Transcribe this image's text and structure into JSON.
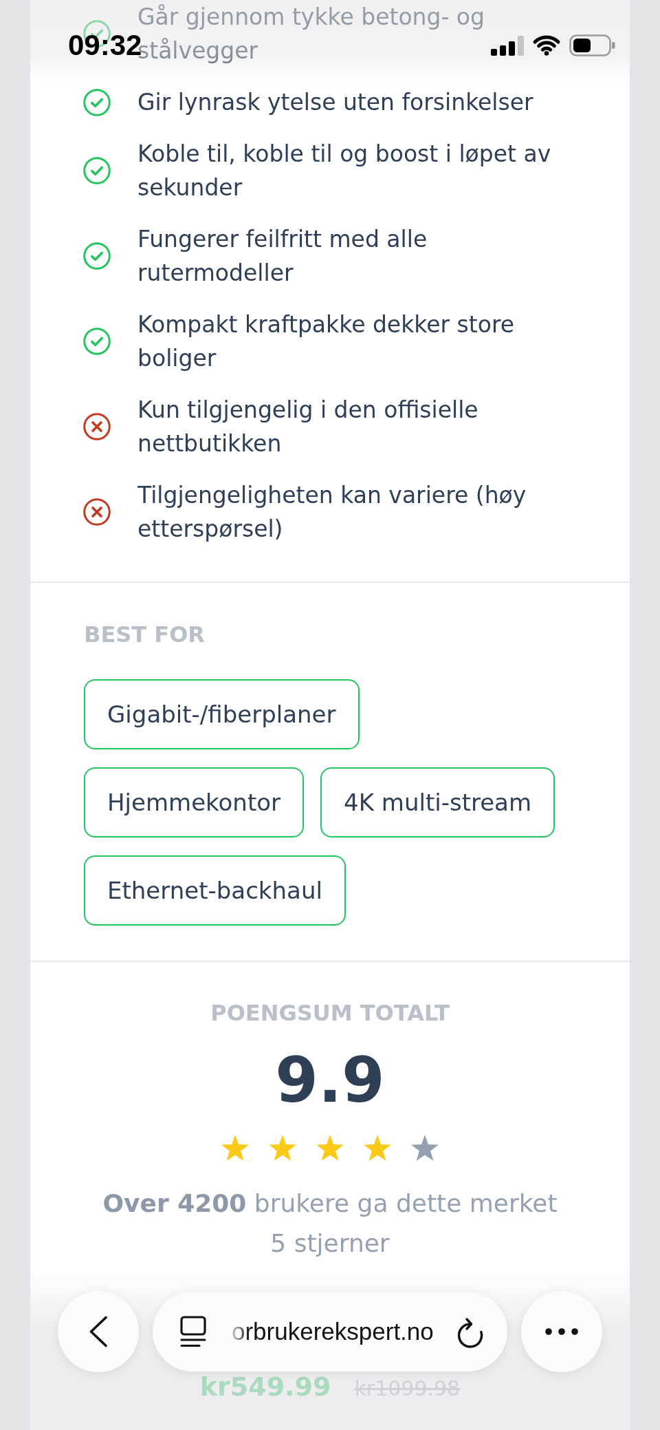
{
  "status_bar": {
    "time": "09:32"
  },
  "features": [
    {
      "kind": "pro",
      "text": "Går gjennom tykke betong- og stålvegger"
    },
    {
      "kind": "pro",
      "text": "Gir lynrask ytelse uten forsinkelser"
    },
    {
      "kind": "pro",
      "text": "Koble til, koble til og boost i løpet av sekunder"
    },
    {
      "kind": "pro",
      "text": "Fungerer feilfritt med alle rutermodeller"
    },
    {
      "kind": "pro",
      "text": "Kompakt kraftpakke dekker store boliger"
    },
    {
      "kind": "con",
      "text": "Kun tilgjengelig i den offisielle nettbutikken"
    },
    {
      "kind": "con",
      "text": "Tilgjengeligheten kan variere (høy etterspørsel)"
    }
  ],
  "best_for": {
    "heading": "BEST FOR",
    "tags": [
      "Gigabit-/fiberplaner",
      "Hjemmekontor",
      "4K multi-stream",
      "Ethernet-backhaul"
    ]
  },
  "score": {
    "heading": "POENGSUM TOTALT",
    "value": "9.9",
    "stars": 4,
    "summary": "**Over 4200** brukere ga dette merket 5 stjerner"
  },
  "price": {
    "current": "kr549.99",
    "original": "kr1099.98"
  },
  "browser_bar": {
    "url": "orbrukerekspert.no"
  }
}
